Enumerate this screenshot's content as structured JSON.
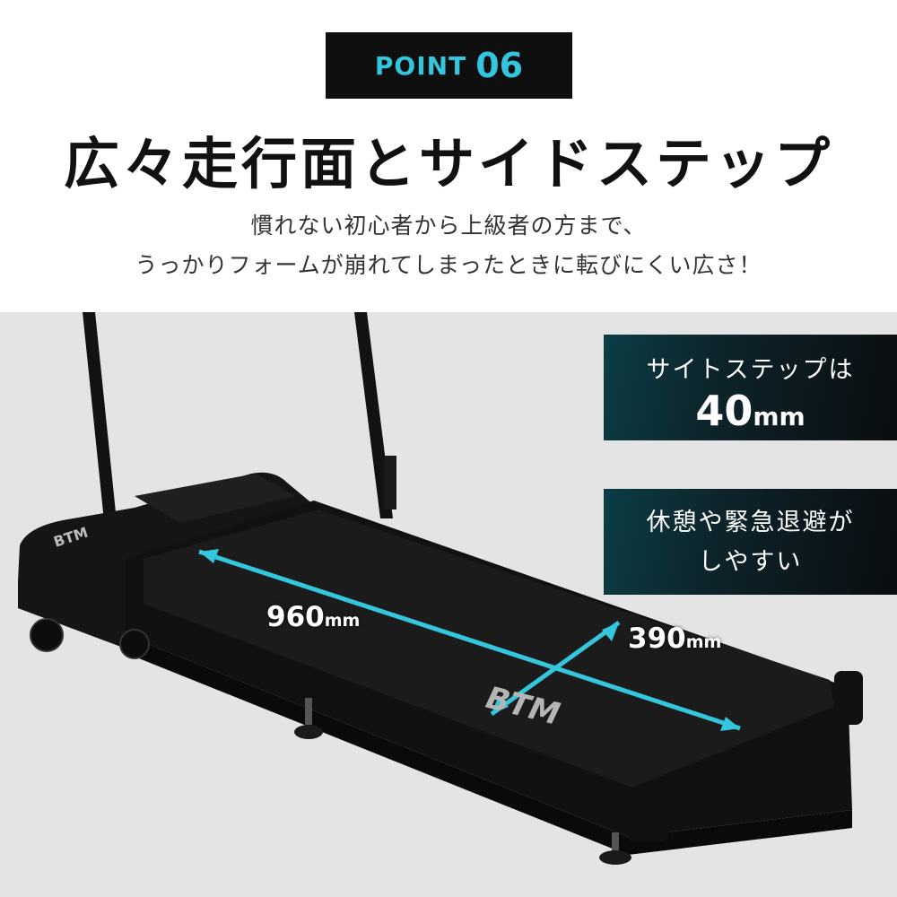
{
  "badge": {
    "word": "POINT",
    "number": "06"
  },
  "headline": "広々走行面とサイドステップ",
  "subcopy": {
    "line1": "慣れない初心者から上級者の方まで、",
    "line2": "うっかりフォームが崩れてしまったときに転びにくい広さ！"
  },
  "side_step_box": {
    "line1": "サイトステップは",
    "value": "40",
    "unit": "mm"
  },
  "rest_box": {
    "line1": "休憩や緊急退避が",
    "line2": "しやすい"
  },
  "dimensions": {
    "length": {
      "value": "960",
      "unit": "mm"
    },
    "width": {
      "value": "390",
      "unit": "mm"
    }
  },
  "brand_logo": "BTM",
  "colors": {
    "accent": "#34c6dc",
    "badge_bg": "#0f0f0f",
    "photo_bg": "#e4e4e4"
  }
}
